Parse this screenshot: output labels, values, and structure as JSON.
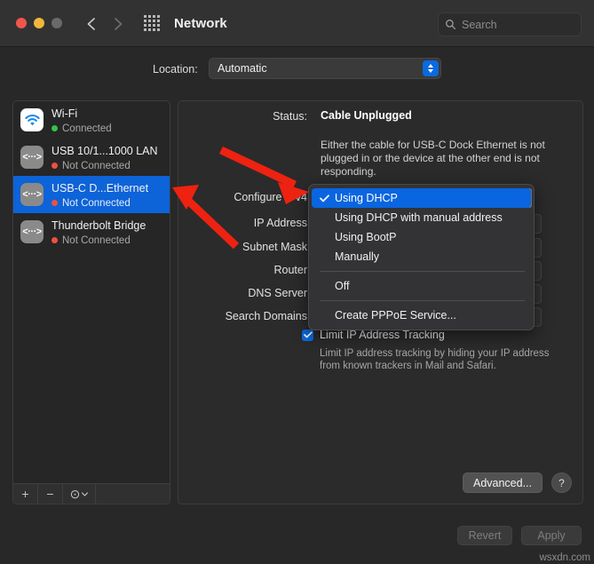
{
  "window": {
    "title": "Network",
    "traffic_lights": [
      "close",
      "minimize",
      "zoom"
    ],
    "back_icon": "chevron-left-icon",
    "forward_icon": "chevron-right-icon",
    "grid_icon": "grid-apps-icon"
  },
  "search": {
    "placeholder": "Search",
    "icon": "search-icon",
    "value": ""
  },
  "location": {
    "label": "Location:",
    "selected": "Automatic",
    "options": [
      "Automatic"
    ]
  },
  "sidebar": {
    "items": [
      {
        "name": "Wi-Fi",
        "status": "Connected",
        "status_color": "#31c44c",
        "icon": "wifi-icon",
        "selected": false
      },
      {
        "name": "USB 10/1...1000 LAN",
        "status": "Not Connected",
        "status_color": "#f0503f",
        "icon": "ethernet-icon",
        "selected": false
      },
      {
        "name": "USB-C D...Ethernet",
        "status": "Not Connected",
        "status_color": "#f0503f",
        "icon": "ethernet-icon",
        "selected": true
      },
      {
        "name": "Thunderbolt Bridge",
        "status": "Not Connected",
        "status_color": "#f0503f",
        "icon": "ethernet-icon",
        "selected": false
      }
    ],
    "footer": {
      "add_label": "+",
      "remove_label": "−",
      "actions_label": "⊙",
      "actions_chevron": "chevron-down-icon"
    }
  },
  "detail": {
    "status_label": "Status:",
    "status_value": "Cable Unplugged",
    "status_description": "Either the cable for USB-C Dock Ethernet is not plugged in or the device at the other end is not responding.",
    "fields": [
      {
        "label": "Configure IPv4",
        "value": ""
      },
      {
        "label": "IP Address",
        "value": ""
      },
      {
        "label": "Subnet Mask",
        "value": ""
      },
      {
        "label": "Router",
        "value": ""
      },
      {
        "label": "DNS Server",
        "value": ""
      },
      {
        "label": "Search Domains",
        "value": ""
      }
    ],
    "limit_tracking": {
      "label": "Limit IP Address Tracking",
      "checked": true,
      "description": "Limit IP address tracking by hiding your IP address from known trackers in Mail and Safari."
    },
    "advanced_label": "Advanced...",
    "help_label": "?"
  },
  "popup_menu": {
    "items": [
      {
        "label": "Using DHCP",
        "checked": true,
        "selected": true
      },
      {
        "label": "Using DHCP with manual address",
        "checked": false,
        "selected": false
      },
      {
        "label": "Using BootP",
        "checked": false,
        "selected": false
      },
      {
        "label": "Manually",
        "checked": false,
        "selected": false
      },
      {
        "label": "Off",
        "checked": false,
        "selected": false
      },
      {
        "label": "Create PPPoE Service...",
        "checked": false,
        "selected": false
      }
    ],
    "check_icon": "checkmark-icon"
  },
  "footer_buttons": {
    "revert_label": "Revert",
    "apply_label": "Apply"
  },
  "watermark": "wsxdn.com",
  "colors": {
    "accent_blue": "#0a65e0",
    "selection_blue": "#0d63d8",
    "connected_green": "#31c44c",
    "disconnected_red": "#f0503f",
    "annotation_red": "#ee2211",
    "window_bg": "#282828",
    "panel_bg": "#2b2b2b"
  }
}
